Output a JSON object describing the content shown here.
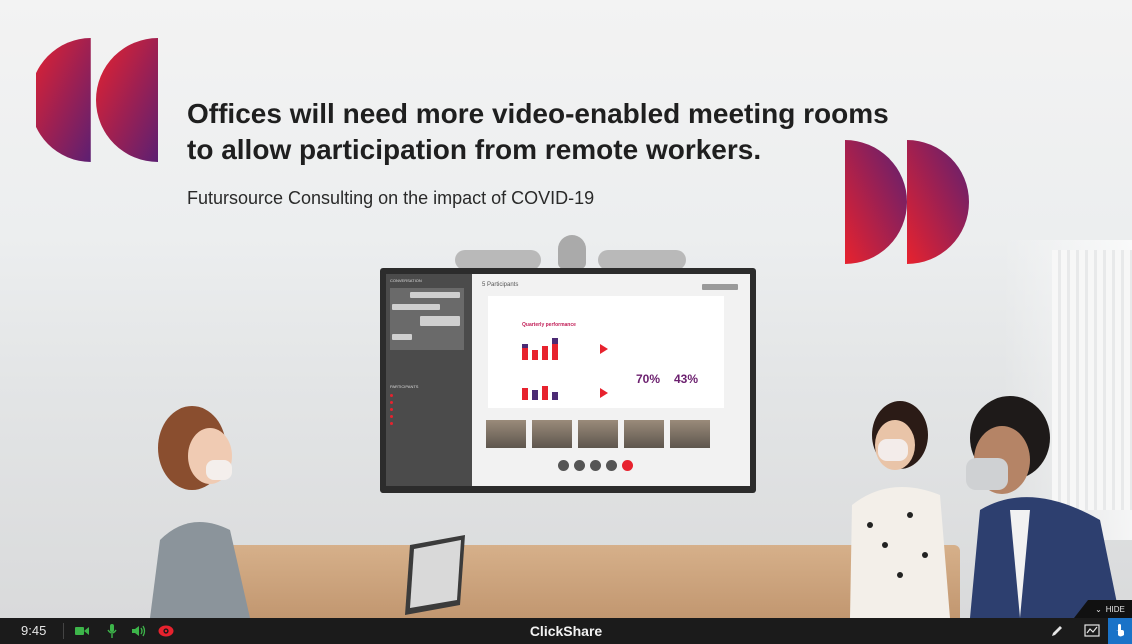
{
  "slide": {
    "headline_line1": "Offices will need more video-enabled meeting rooms",
    "headline_line2": "to allow participation from remote workers.",
    "attribution": "Futursource Consulting on the impact of COVID-19",
    "quote_colors": [
      "#e7222e",
      "#6b1f6e"
    ]
  },
  "screen": {
    "participants": "5 Participants",
    "conversation_label": "CONVERSATION",
    "participants_label": "PARTICIPANTS",
    "doc_title": "Quarterly performance",
    "kpi1": "70%",
    "kpi2": "43%"
  },
  "taskbar": {
    "time": "9:45",
    "brand": "ClickShare",
    "hide_label": "HIDE",
    "icons": [
      "camera-icon",
      "microphone-icon",
      "speaker-icon",
      "eye-icon",
      "pen-icon",
      "whiteboard-icon",
      "touch-icon"
    ]
  }
}
